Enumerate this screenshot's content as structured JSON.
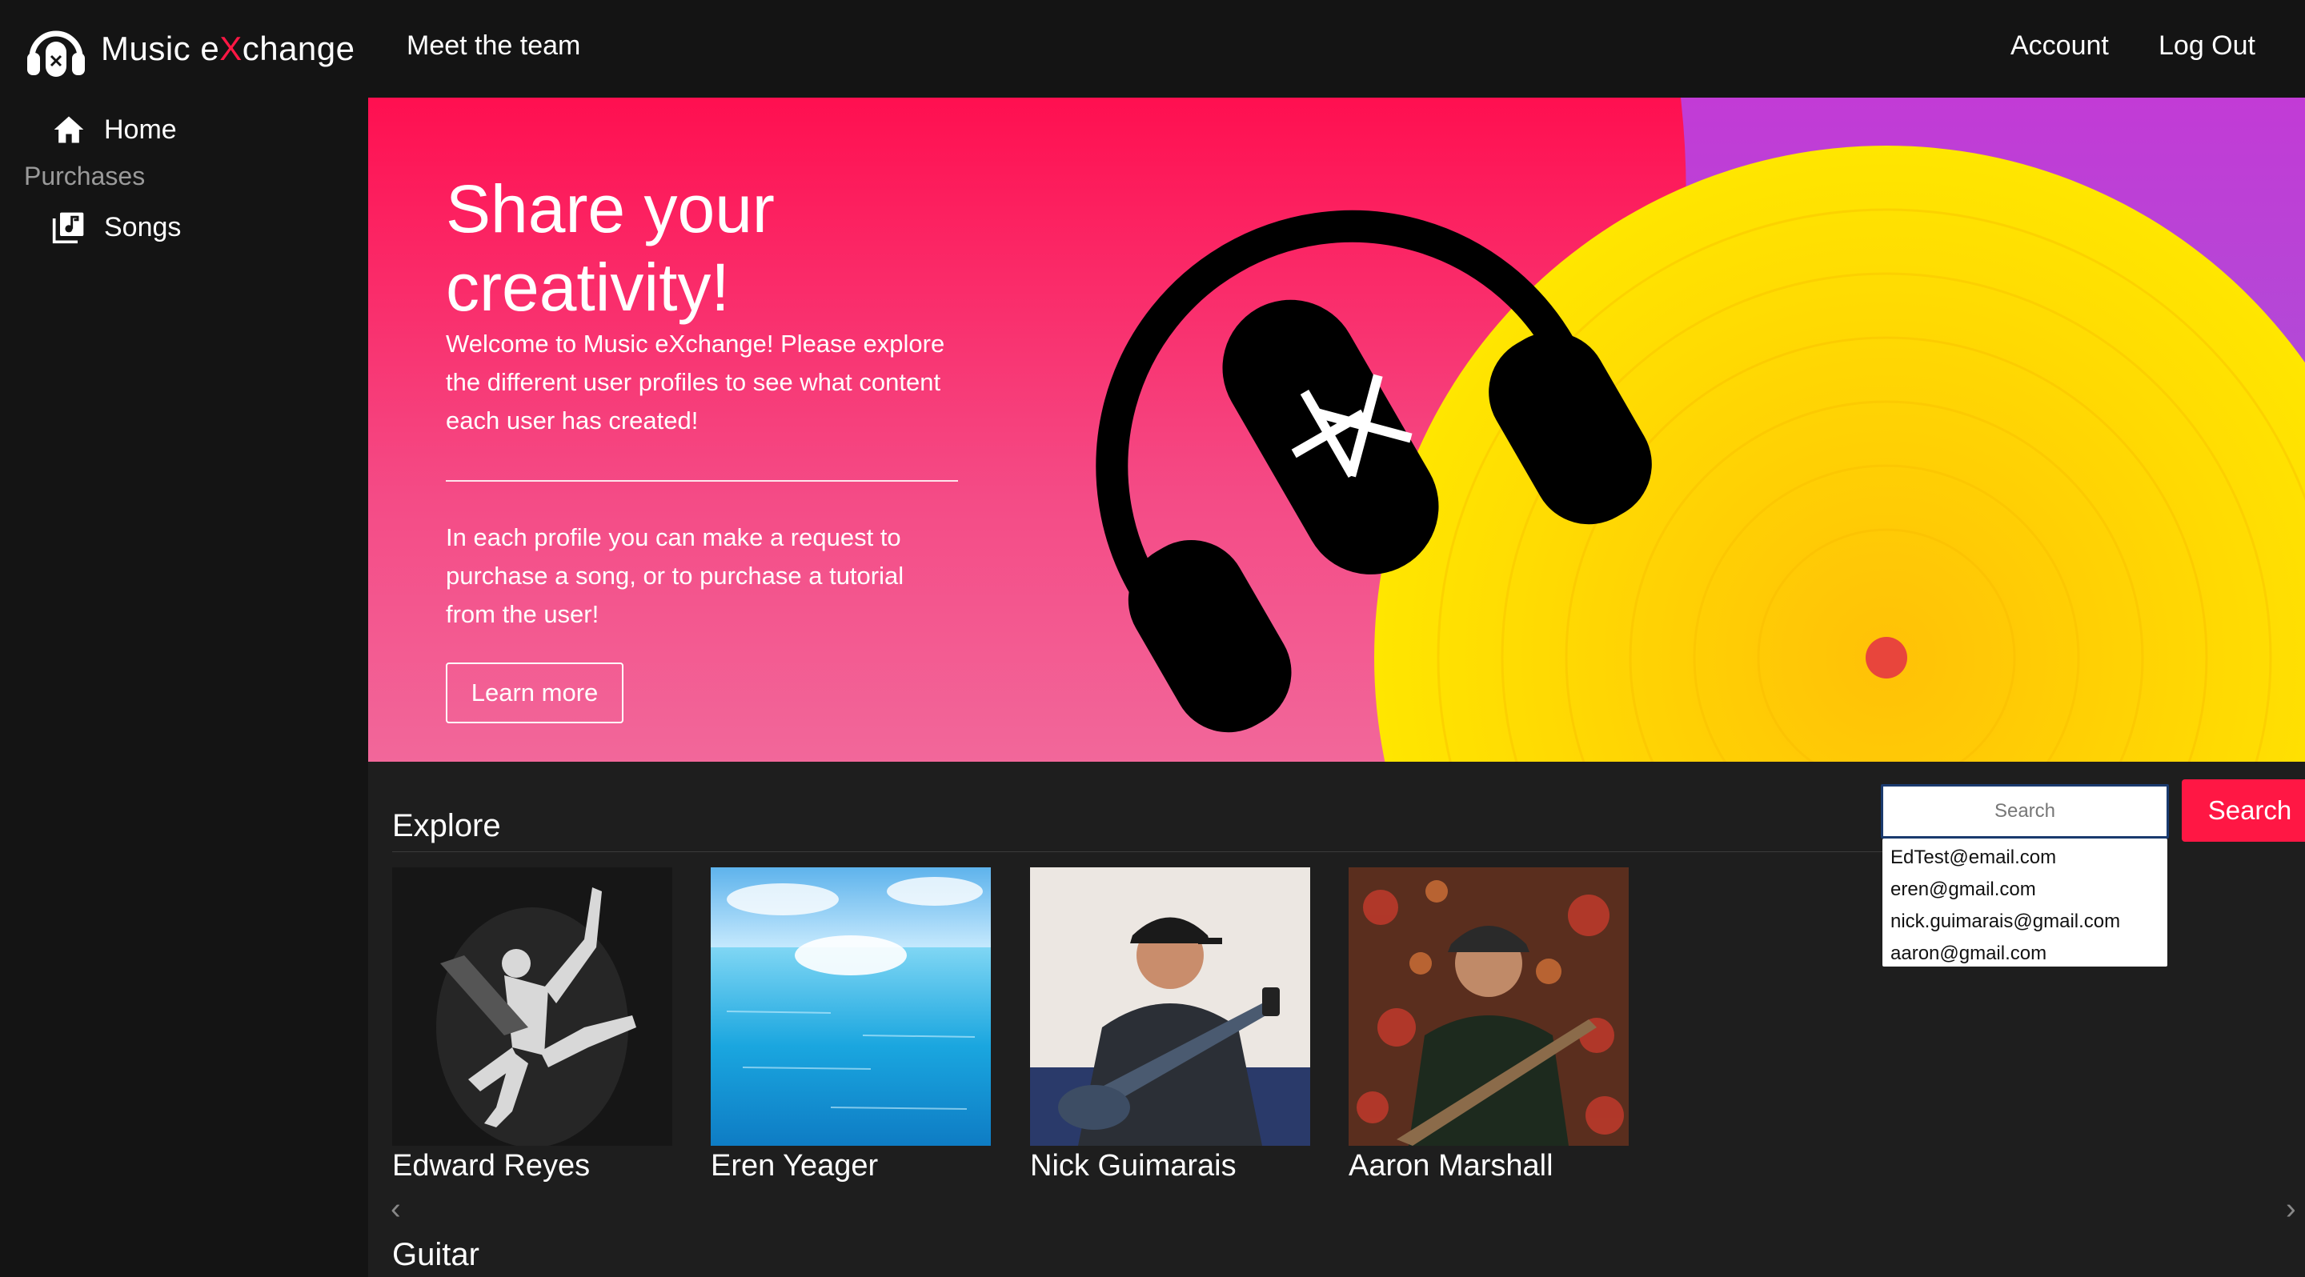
{
  "navbar": {
    "brand_left": "Music e",
    "brand_x": "X",
    "brand_right": "change",
    "meet_team": "Meet the team",
    "account": "Account",
    "logout": "Log Out"
  },
  "sidebar": {
    "home": "Home",
    "purchases_heading": "Purchases",
    "songs": "Songs",
    "icons": [
      "home-icon",
      "music-library-icon"
    ]
  },
  "hero": {
    "title": "Share your creativity!",
    "paragraph1": "Welcome to Music eXchange! Please explore the different user profiles to see what content each user has created!",
    "paragraph2": "In each profile you can make a request to purchase a song, or to purchase a tutorial from the user!",
    "learn_more": "Learn more"
  },
  "explore": {
    "title": "Explore",
    "search_placeholder": "Search",
    "search_button": "Search",
    "suggestions": [
      "EdTest@email.com",
      "eren@gmail.com",
      "nick.guimarais@gmail.com",
      "aaron@gmail.com"
    ],
    "profiles": [
      {
        "name": "Edward Reyes"
      },
      {
        "name": "Eren Yeager"
      },
      {
        "name": "Nick Guimarais"
      },
      {
        "name": "Aaron Marshall"
      }
    ],
    "prev_arrow": "‹",
    "next_arrow": "›"
  },
  "guitar": {
    "title": "Guitar"
  },
  "colors": {
    "accent": "#ff1744",
    "nav_bg": "#141414",
    "page_bg": "#1e1e1e",
    "hero_yellow": "#ffd600",
    "hero_purple": "#b455d8"
  }
}
